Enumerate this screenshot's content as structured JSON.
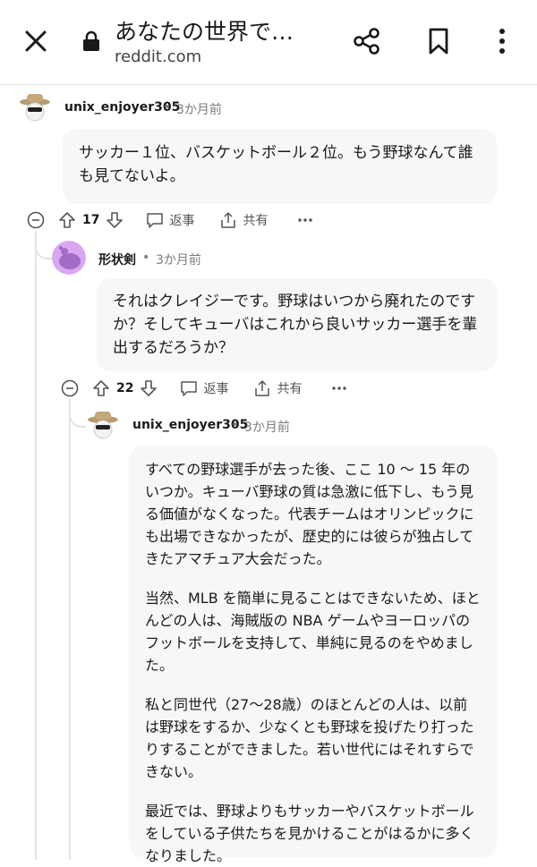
{
  "header": {
    "title": "あなたの世界で…",
    "domain": "reddit.com"
  },
  "comments": [
    {
      "username": "unix_enjoyer305",
      "age": "3か月前",
      "paragraphs": [
        "サッカー１位、バスケットボール２位。もう野球なんて誰も見てないよ。"
      ],
      "votes": "17",
      "reply_label": "返事",
      "share_label": "共有"
    },
    {
      "username": "形状剣",
      "age": "3か月前",
      "paragraphs": [
        "それはクレイジーです。野球はいつから廃れたのですか？そしてキューバはこれから良いサッカー選手を輩出するだろうか？"
      ],
      "votes": "22",
      "reply_label": "返事",
      "share_label": "共有"
    },
    {
      "username": "unix_enjoyer305",
      "age": "3か月前",
      "paragraphs": [
        "すべての野球選手が去った後、ここ 10 〜 15 年のいつか。キューバ野球の質は急激に低下し、もう見る価値がなくなった。代表チームはオリンピックにも出場できなかったが、歴史的には彼らが独占してきたアマチュア大会だった。",
        "当然、MLB を簡単に見ることはできないため、ほとんどの人は、海賊版の NBA ゲームやヨーロッパのフットボールを支持して、単純に見るのをやめました。",
        "私と同世代（27〜28歳）のほとんどの人は、以前は野球をするか、少なくとも野球を投げたり打ったりすることができました。若い世代にはそれすらできない。",
        "最近では、野球よりもサッカーやバスケットボールをしている子供たちを見かけることがはるかに多くなりました。"
      ]
    }
  ],
  "separator_dot": "•"
}
